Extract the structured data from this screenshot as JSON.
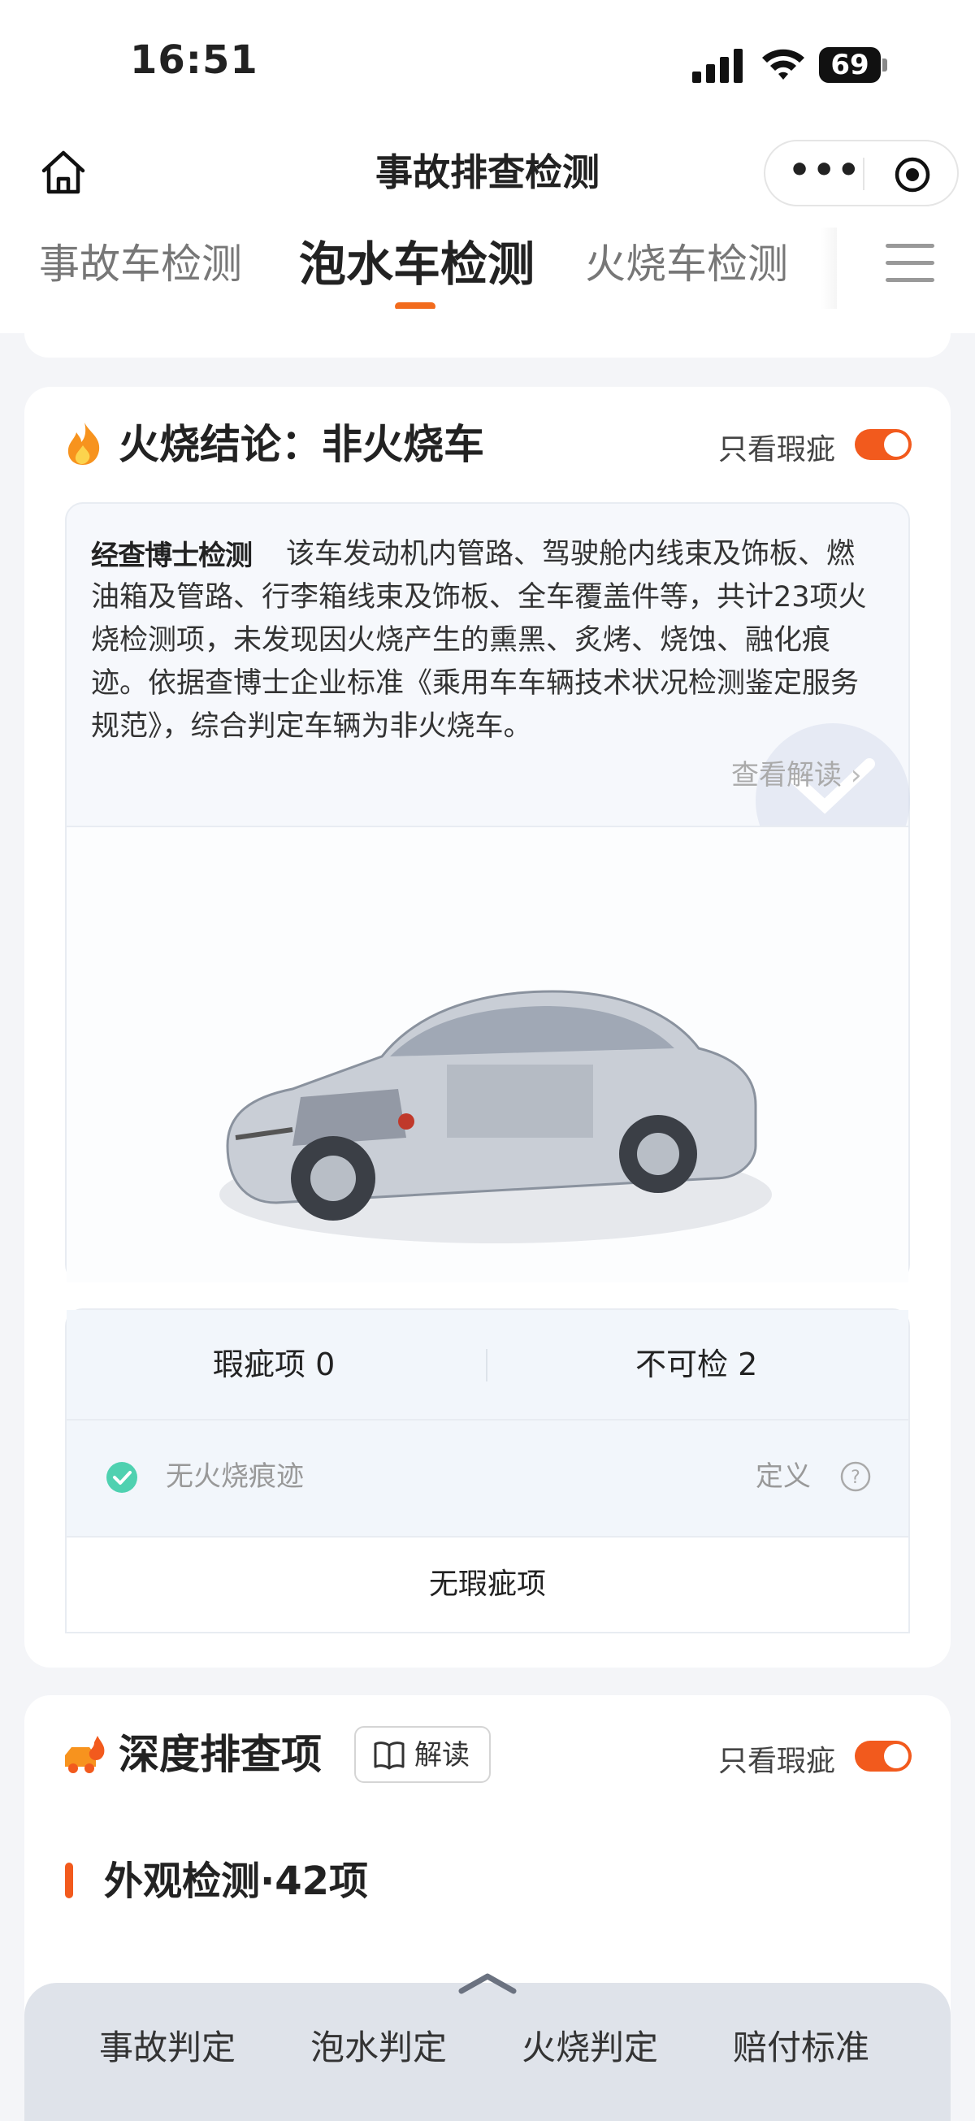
{
  "status_bar": {
    "time": "16:51",
    "battery": "69"
  },
  "nav": {
    "title": "事故排查检测"
  },
  "tabs": [
    {
      "label": "事故车检测",
      "active": false
    },
    {
      "label": "泡水车检测",
      "active": true
    },
    {
      "label": "火烧车检测",
      "active": false
    }
  ],
  "fire_section": {
    "title": "火烧结论：非火烧车",
    "only_flaw_label": "只看瑕疵",
    "only_flaw_on": true,
    "brand": "经查博士检测",
    "summary": "该车发动机内管路、驾驶舱内线束及饰板、燃油箱及管路、行李箱线束及饰板、全车覆盖件等，共计23项火烧检测项，未发现因火烧产生的熏黑、炙烤、烧蚀、融化痕迹。依据查博士企业标准《乘用车车辆技术状况检测鉴定服务规范》，综合判定车辆为非火烧车。",
    "read_link": "查看解读",
    "stats": {
      "flaw": "瑕疵项 0",
      "uncheckable": "不可检 2"
    },
    "row": {
      "label": "无火烧痕迹",
      "def": "定义"
    },
    "no_flaw": "无瑕疵项"
  },
  "deep_section": {
    "title": "深度排查项",
    "interp_button": "解读",
    "only_flaw_label": "只看瑕疵",
    "only_flaw_on": true,
    "sub_title": "外观检测·42项"
  },
  "bottom_tabs": [
    "事故判定",
    "泡水判定",
    "火烧判定",
    "赔付标准"
  ],
  "colors": {
    "accent": "#f25a1d",
    "check": "#4fd1b0"
  },
  "icons": [
    "home-icon",
    "more-icon",
    "target-icon",
    "menu-icon",
    "flame-icon",
    "check-circle-icon",
    "help-icon",
    "car-fire-icon",
    "book-icon",
    "chevron-up-icon"
  ]
}
